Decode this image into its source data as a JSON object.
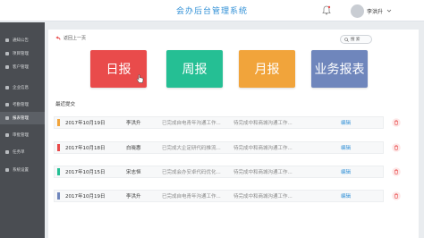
{
  "app": {
    "title": "会办后台管理系统",
    "user_name": "李洪升"
  },
  "sidebar": {
    "items": [
      {
        "label": "通知公告"
      },
      {
        "label": "项目管理"
      },
      {
        "label": "客户管理"
      },
      {
        "label": "企业信息"
      },
      {
        "label": "考勤管理"
      },
      {
        "label": "报表管理"
      },
      {
        "label": "审批管理"
      },
      {
        "label": "任务单"
      },
      {
        "label": "系统设置"
      }
    ],
    "active_index": 5
  },
  "toolbar": {
    "back_label": "返回上一页",
    "search_label": "搜 索"
  },
  "tiles": {
    "daily": "日报",
    "weekly": "周报",
    "monthly": "月报",
    "business": "业务报表"
  },
  "recent": {
    "title": "最近提交",
    "rows": [
      {
        "date": "2017年10月19日",
        "person": "李洪升",
        "summary": "已完成自电青年沟通工作...",
        "todo": "待完成中和商城沟通工作...",
        "action": "编辑",
        "color": "#f1a43b"
      },
      {
        "date": "2017年10月18日",
        "person": "白晓惠",
        "summary": "已完成大企定研代码推流...",
        "todo": "待完成中和商城沟通工作...",
        "action": "编辑",
        "color": "#e94b4b"
      },
      {
        "date": "2017年10月15日",
        "person": "宋志恒",
        "summary": "已完成会办安卓代码优化...",
        "todo": "待完成中和商城沟通工作...",
        "action": "编辑",
        "color": "#25bf94"
      },
      {
        "date": "2017年10月19日",
        "person": "李洪升",
        "summary": "已完成自电青年沟通工作...",
        "todo": "待完成中和商城沟通工作...",
        "action": "编辑",
        "color": "#6f86bc"
      }
    ]
  }
}
